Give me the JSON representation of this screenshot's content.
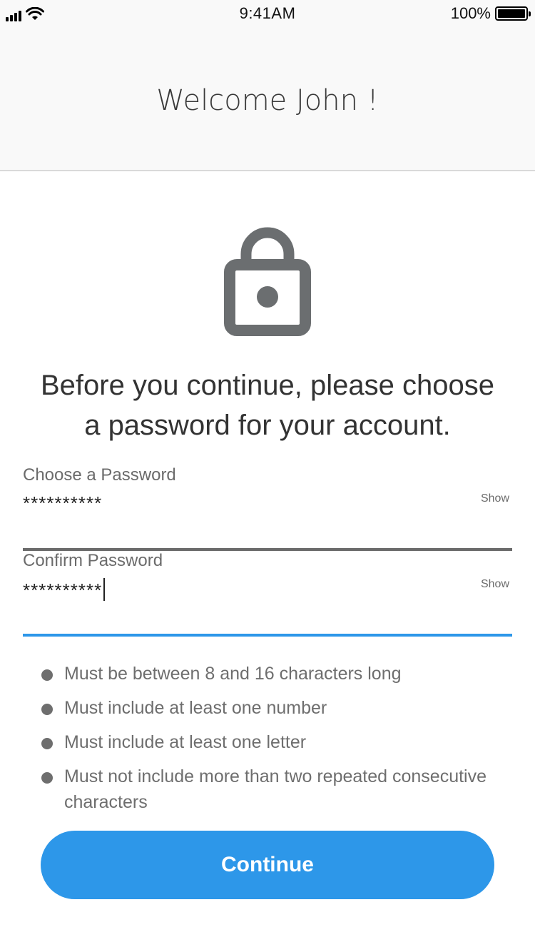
{
  "status_bar": {
    "time": "9:41AM",
    "battery": "100%"
  },
  "header": {
    "title": "Welcome John !"
  },
  "icons": {
    "lock": "lock-icon"
  },
  "intro": {
    "line1": "Before you continue, please choose",
    "line2": "a password for your account."
  },
  "fields": {
    "password": {
      "label": "Choose a Password",
      "value": "**********",
      "show": "Show"
    },
    "confirm": {
      "label": "Confirm Password",
      "value": "**********",
      "show": "Show"
    }
  },
  "rules": [
    "Must be between 8 and 16 characters long",
    "Must include at least one number",
    "Must include at least one letter",
    "Must not include more than two repeated consecutive characters"
  ],
  "button": {
    "continue": "Continue"
  },
  "colors": {
    "accent": "#2d97e9",
    "icon": "#6b6e70",
    "text_muted": "#6e6e6e"
  }
}
